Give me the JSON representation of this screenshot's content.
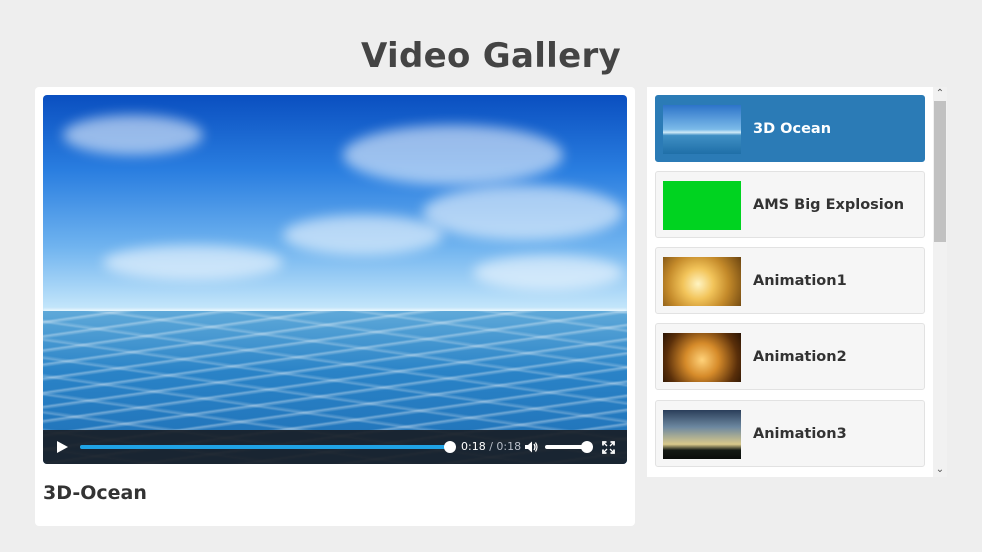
{
  "page": {
    "title": "Video Gallery"
  },
  "player": {
    "title": "3D-Ocean",
    "current_time": "0:18",
    "separator": "/",
    "duration": "0:18",
    "progress_fraction": 1.0,
    "volume_fraction": 0.85,
    "accent_color": "#1fa3e6"
  },
  "playlist": {
    "active_color": "#2b7bb6",
    "items": [
      {
        "label": "3D Ocean",
        "active": true
      },
      {
        "label": "AMS Big Explosion",
        "active": false
      },
      {
        "label": "Animation1",
        "active": false
      },
      {
        "label": "Animation2",
        "active": false
      },
      {
        "label": "Animation3",
        "active": false
      }
    ]
  },
  "icons": {
    "play": "play-icon",
    "volume": "volume-icon",
    "fullscreen": "fullscreen-icon",
    "scroll_up": "chevron-up-icon",
    "scroll_down": "chevron-down-icon"
  }
}
